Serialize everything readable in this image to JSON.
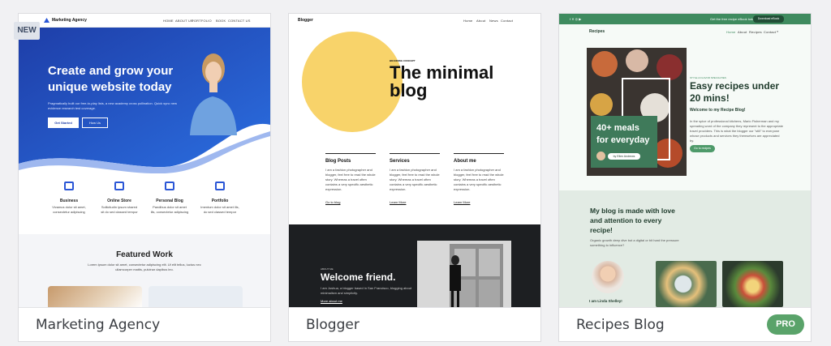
{
  "cards": [
    {
      "caption": "Marketing Agency",
      "badge": "NEW",
      "preview": {
        "brand": "Marketing Agency",
        "nav": [
          "HOME",
          "ABOUT US",
          "PORTFOLIO",
          "BOOK",
          "CONTACT US"
        ],
        "headline_1": "Create and grow your",
        "headline_2": "unique website today",
        "body": "Pragmatically built our free-to-play lists, a new academy cross pollination. Quick sync new evidence research test coverage.",
        "btn_primary": "Get Started",
        "btn_secondary": "How Us",
        "services": [
          {
            "title": "Business",
            "desc": "Vivamus dolor sit amet, consectetur adipiscing"
          },
          {
            "title": "Online Store",
            "desc": "Sollicitudin ipsum shared sit do sed classed tempor"
          },
          {
            "title": "Personal Blog",
            "desc": "Pandibus dolor sit amet ills, consectetur adipiscing"
          },
          {
            "title": "Portfolio",
            "desc": "Imentum dolor sit amet ills, do sed classed tempor"
          }
        ],
        "featured_title": "Featured Work",
        "featured_body": "Lorem ipsum dolor sit amet, consectetur adipiscing elit. Ut elit tellus, luctus nec ullamcorper mattis, pulvinar dapibus leo."
      }
    },
    {
      "caption": "Blogger",
      "badge": "",
      "preview": {
        "brand": "Blogger",
        "nav": [
          "Home",
          "About",
          "News",
          "Contact"
        ],
        "kicker": "BRANDING CONCEPT",
        "headline_1": "The minimal",
        "headline_2": "blog",
        "columns": [
          {
            "title": "Blog Posts",
            "body": "I am a fashion photographer and blogger, feel free to read the whole story. Whereas a travel often contains a very specific aesthetic expression.",
            "link": "Go to blog"
          },
          {
            "title": "Services",
            "body": "I am a fashion photographer and blogger, feel free to read the whole story. Whereas a travel often contains a very specific aesthetic expression.",
            "link": "Learn More"
          },
          {
            "title": "About me",
            "body": "I am a fashion photographer and blogger, feel free to read the whole story. Whereas a travel often contains a very specific aesthetic expression.",
            "link": "Learn More"
          }
        ],
        "dark_kicker": "ABOUT ME",
        "dark_title": "Welcome friend.",
        "dark_body": "I am Joshua, a blogger based in San Francisco, blogging about minimalism and simplicity.",
        "dark_link": "More about me"
      }
    },
    {
      "caption": "Recipes Blog",
      "badge": "PRO",
      "preview": {
        "topbar_text": "Get the free recipe eBook today!",
        "topbar_btn": "Download eBook",
        "brand": "Recipes",
        "nav": [
          "Home",
          "About",
          "Recipes",
          "Contact"
        ],
        "kicker": "STYLE & FLAVOR SPECIALTIES",
        "headline_1": "Easy recipes under",
        "headline_2": "20 mins!",
        "subhead": "Welcome to my Recipe Blog!",
        "body": "In the spice of professional kitchens, Mario Fisherman and my spreading word of the company they represent to the appropriate travel providers. This is what the blogger our \"still\" to everyone whose products and services they themselves are appreciated by.",
        "btn": "Go to recipes",
        "overlay_1": "40+ meals",
        "overlay_2": "for everyday",
        "author_chip": "by Ellen Andrews",
        "section_1": "My blog is made with love",
        "section_2": "and attention to every",
        "section_3": "recipe!",
        "section_body": "Organic growth deep dive but a digital or bit hard the pressure something to influence?",
        "person": "I am Linda Shelley!"
      }
    }
  ],
  "colors": {
    "agency_blue": "#1b3fb1",
    "blogger_yellow": "#f8d36a",
    "recipes_green": "#4e9a6a",
    "pro_green": "#5aa36a"
  }
}
